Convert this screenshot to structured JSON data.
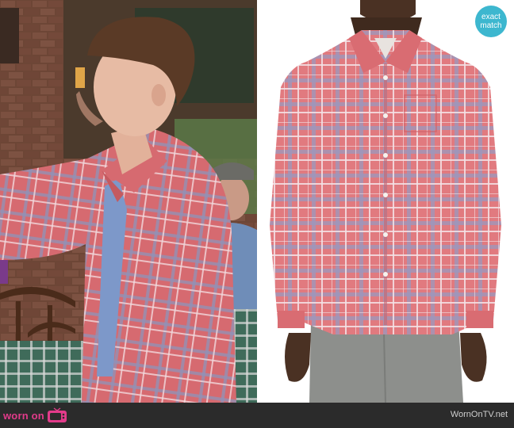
{
  "badge": {
    "text": "exact match"
  },
  "footer": {
    "logo_text": "worn on",
    "site_text": "WornOnTV.net"
  },
  "icons": {
    "logo_tv": "tv-icon"
  },
  "colors": {
    "shirt_red": "#d9656b",
    "badge_teal": "#3db7cf",
    "bar": "#2b2b2b",
    "logo_pink": "#e23b8a"
  }
}
